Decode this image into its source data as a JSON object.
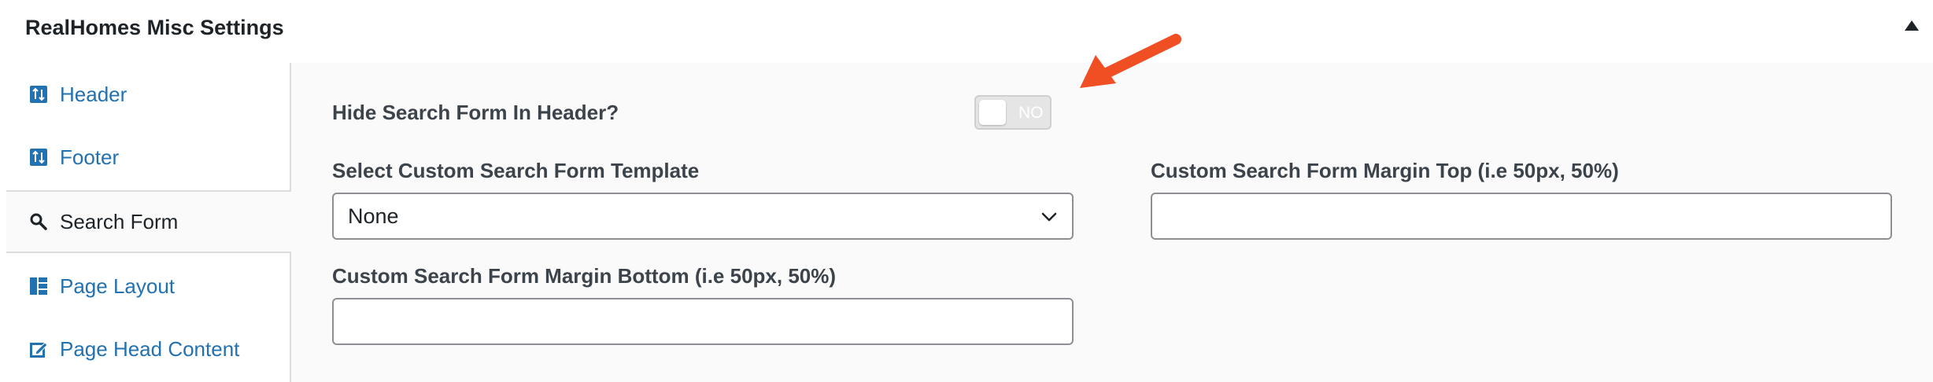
{
  "panel": {
    "title": "RealHomes Misc Settings"
  },
  "sidebar": {
    "items": [
      {
        "label": "Header",
        "icon": "sort-arrows-icon",
        "active": false
      },
      {
        "label": "Footer",
        "icon": "sort-arrows-icon",
        "active": false
      },
      {
        "label": "Search Form",
        "icon": "search-icon",
        "active": true
      },
      {
        "label": "Page Layout",
        "icon": "layout-icon",
        "active": false
      },
      {
        "label": "Page Head Content",
        "icon": "edit-icon",
        "active": false
      }
    ]
  },
  "fields": {
    "hide_search": {
      "label": "Hide Search Form In Header?",
      "toggle_state": "NO"
    },
    "template": {
      "label": "Select Custom Search Form Template",
      "selected": "None"
    },
    "margin_top": {
      "label": "Custom Search Form Margin Top (i.e 50px, 50%)",
      "value": ""
    },
    "margin_bottom": {
      "label": "Custom Search Form Margin Bottom (i.e 50px, 50%)",
      "value": ""
    }
  },
  "colors": {
    "link": "#2271b1",
    "annotation_arrow": "#f04e23"
  }
}
